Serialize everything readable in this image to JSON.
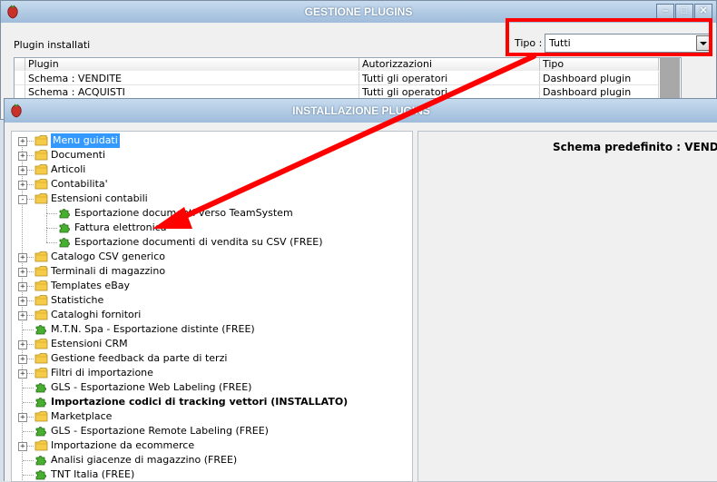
{
  "back_window": {
    "title": "GESTIONE PLUGINS",
    "installed_label": "Plugin installati",
    "tipo_label": "Tipo :",
    "tipo_value": "Tutti",
    "columns": [
      "Plugin",
      "Autorizzazioni",
      "Tipo"
    ],
    "rows": [
      [
        "Schema : VENDITE",
        "Tutti gli operatori",
        "Dashboard plugin"
      ],
      [
        "Schema : ACQUISTI",
        "Tutti gli operatori",
        "Dashboard plugin"
      ]
    ]
  },
  "front_window": {
    "title": "INSTALLAZIONE PLUGINS",
    "right_heading": "Schema predefinito : VENDIT",
    "tree": [
      {
        "label": "Menu guidati",
        "type": "folder",
        "level": 0,
        "expander": "+",
        "selected": true
      },
      {
        "label": "Documenti",
        "type": "folder",
        "level": 0,
        "expander": "+"
      },
      {
        "label": "Articoli",
        "type": "folder",
        "level": 0,
        "expander": "+"
      },
      {
        "label": "Contabilita'",
        "type": "folder",
        "level": 0,
        "expander": "+"
      },
      {
        "label": "Estensioni contabili",
        "type": "folder",
        "level": 0,
        "expander": "-"
      },
      {
        "label": "Esportazione documenti verso TeamSystem",
        "type": "plugin",
        "level": 1
      },
      {
        "label": "Fattura elettronica",
        "type": "plugin",
        "level": 1
      },
      {
        "label": "Esportazione documenti di vendita su CSV (FREE)",
        "type": "plugin",
        "level": 1
      },
      {
        "label": "Catalogo CSV generico",
        "type": "folder",
        "level": 0,
        "expander": "+"
      },
      {
        "label": "Terminali di magazzino",
        "type": "folder",
        "level": 0,
        "expander": "+"
      },
      {
        "label": "Templates eBay",
        "type": "folder",
        "level": 0,
        "expander": "+"
      },
      {
        "label": "Statistiche",
        "type": "folder",
        "level": 0,
        "expander": "+"
      },
      {
        "label": "Cataloghi fornitori",
        "type": "folder",
        "level": 0,
        "expander": "+"
      },
      {
        "label": "M.T.N. Spa - Esportazione distinte (FREE)",
        "type": "plugin",
        "level": 0
      },
      {
        "label": "Estensioni CRM",
        "type": "folder",
        "level": 0,
        "expander": "+"
      },
      {
        "label": "Gestione feedback da parte di terzi",
        "type": "folder",
        "level": 0,
        "expander": "+"
      },
      {
        "label": "Filtri di importazione",
        "type": "folder",
        "level": 0,
        "expander": "+"
      },
      {
        "label": "GLS - Esportazione Web Labeling (FREE)",
        "type": "plugin",
        "level": 0
      },
      {
        "label": "Importazione codici di tracking vettori (INSTALLATO)",
        "type": "plugin",
        "level": 0,
        "bold": true
      },
      {
        "label": "Marketplace",
        "type": "folder",
        "level": 0,
        "expander": "+"
      },
      {
        "label": "GLS - Esportazione Remote Labeling (FREE)",
        "type": "plugin",
        "level": 0
      },
      {
        "label": "Importazione da ecommerce",
        "type": "folder",
        "level": 0,
        "expander": "+"
      },
      {
        "label": "Analisi giacenze di magazzino (FREE)",
        "type": "plugin",
        "level": 0
      },
      {
        "label": "TNT Italia (FREE)",
        "type": "plugin",
        "level": 0
      }
    ]
  },
  "colors": {
    "highlight": "#ff0000",
    "selection": "#3399ff",
    "folder": "#f5cc4a",
    "plugin": "#48b030"
  },
  "icons": [
    "app-icon",
    "minimize-icon",
    "maximize-icon",
    "close-icon",
    "dropdown-arrow-icon",
    "folder-icon",
    "puzzle-icon"
  ]
}
